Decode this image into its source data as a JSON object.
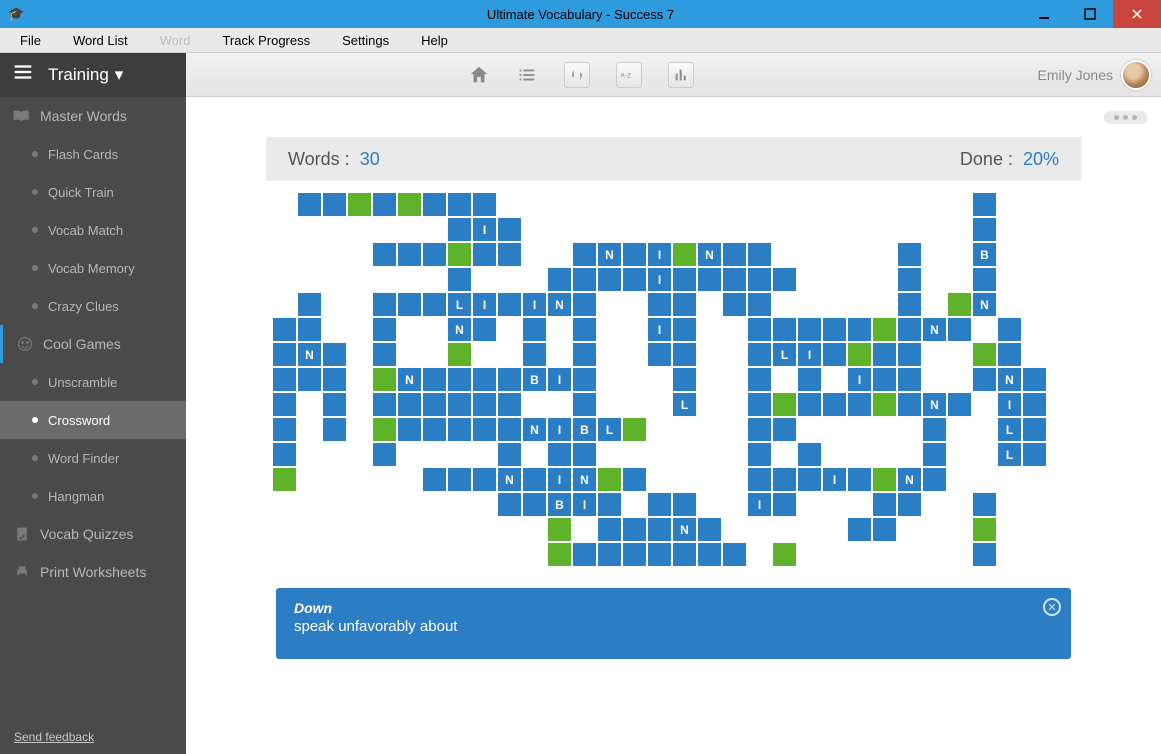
{
  "window": {
    "title": "Ultimate Vocabulary - Success 7"
  },
  "menubar": {
    "file": "File",
    "wordlist": "Word List",
    "word": "Word",
    "track": "Track Progress",
    "settings": "Settings",
    "help": "Help"
  },
  "header": {
    "training": "Training",
    "username": "Emily Jones"
  },
  "sidebar": {
    "master": "Master Words",
    "items1": [
      "Flash Cards",
      "Quick Train",
      "Vocab Match",
      "Vocab Memory",
      "Crazy Clues"
    ],
    "cool": "Cool Games",
    "items2": [
      "Unscramble",
      "Crossword",
      "Word Finder",
      "Hangman"
    ],
    "quizzes": "Vocab Quizzes",
    "print": "Print Worksheets",
    "feedback": "Send feedback"
  },
  "status": {
    "words_label": "Words  :",
    "words_value": "30",
    "done_label": "Done  :",
    "done_value": "20%"
  },
  "clue": {
    "direction": "Down",
    "text": "speak unfavorably about"
  },
  "grid_rows": [
    "..bbgbgbbb...................b..",
    "........bIb..................b..",
    ".....bbbgbb..bNbIgNbb.....b..B..",
    "........b...bbbbIbbbbb....b..b..",
    "..b..bbbLIbINb..bb.bb.....b.gN..",
    ".bb..b..Nb.b.b..Ib..bbbbbgbNb.b.",
    ".bNb.b..g..b.b..bb..bLIbgbb..gb.",
    ".bbb.gNbbbbBIb...b..b.b.Ibb..bNb",
    ".b.b.bbbbbb..b...L..bgbbbgbNb.Ib",
    ".b.b.gbbbbbNIBLg....bb.....b..Lb",
    ".b...b....b.bb......b.b....b..Lb",
    ".g.....bbbNbINgb....bbbIbgNb....",
    "..........bbBIb.bb..Ib...bb..b..",
    "............g.bbbNb.....bb...g..",
    "............gbbbbbbb.g.......b.."
  ]
}
